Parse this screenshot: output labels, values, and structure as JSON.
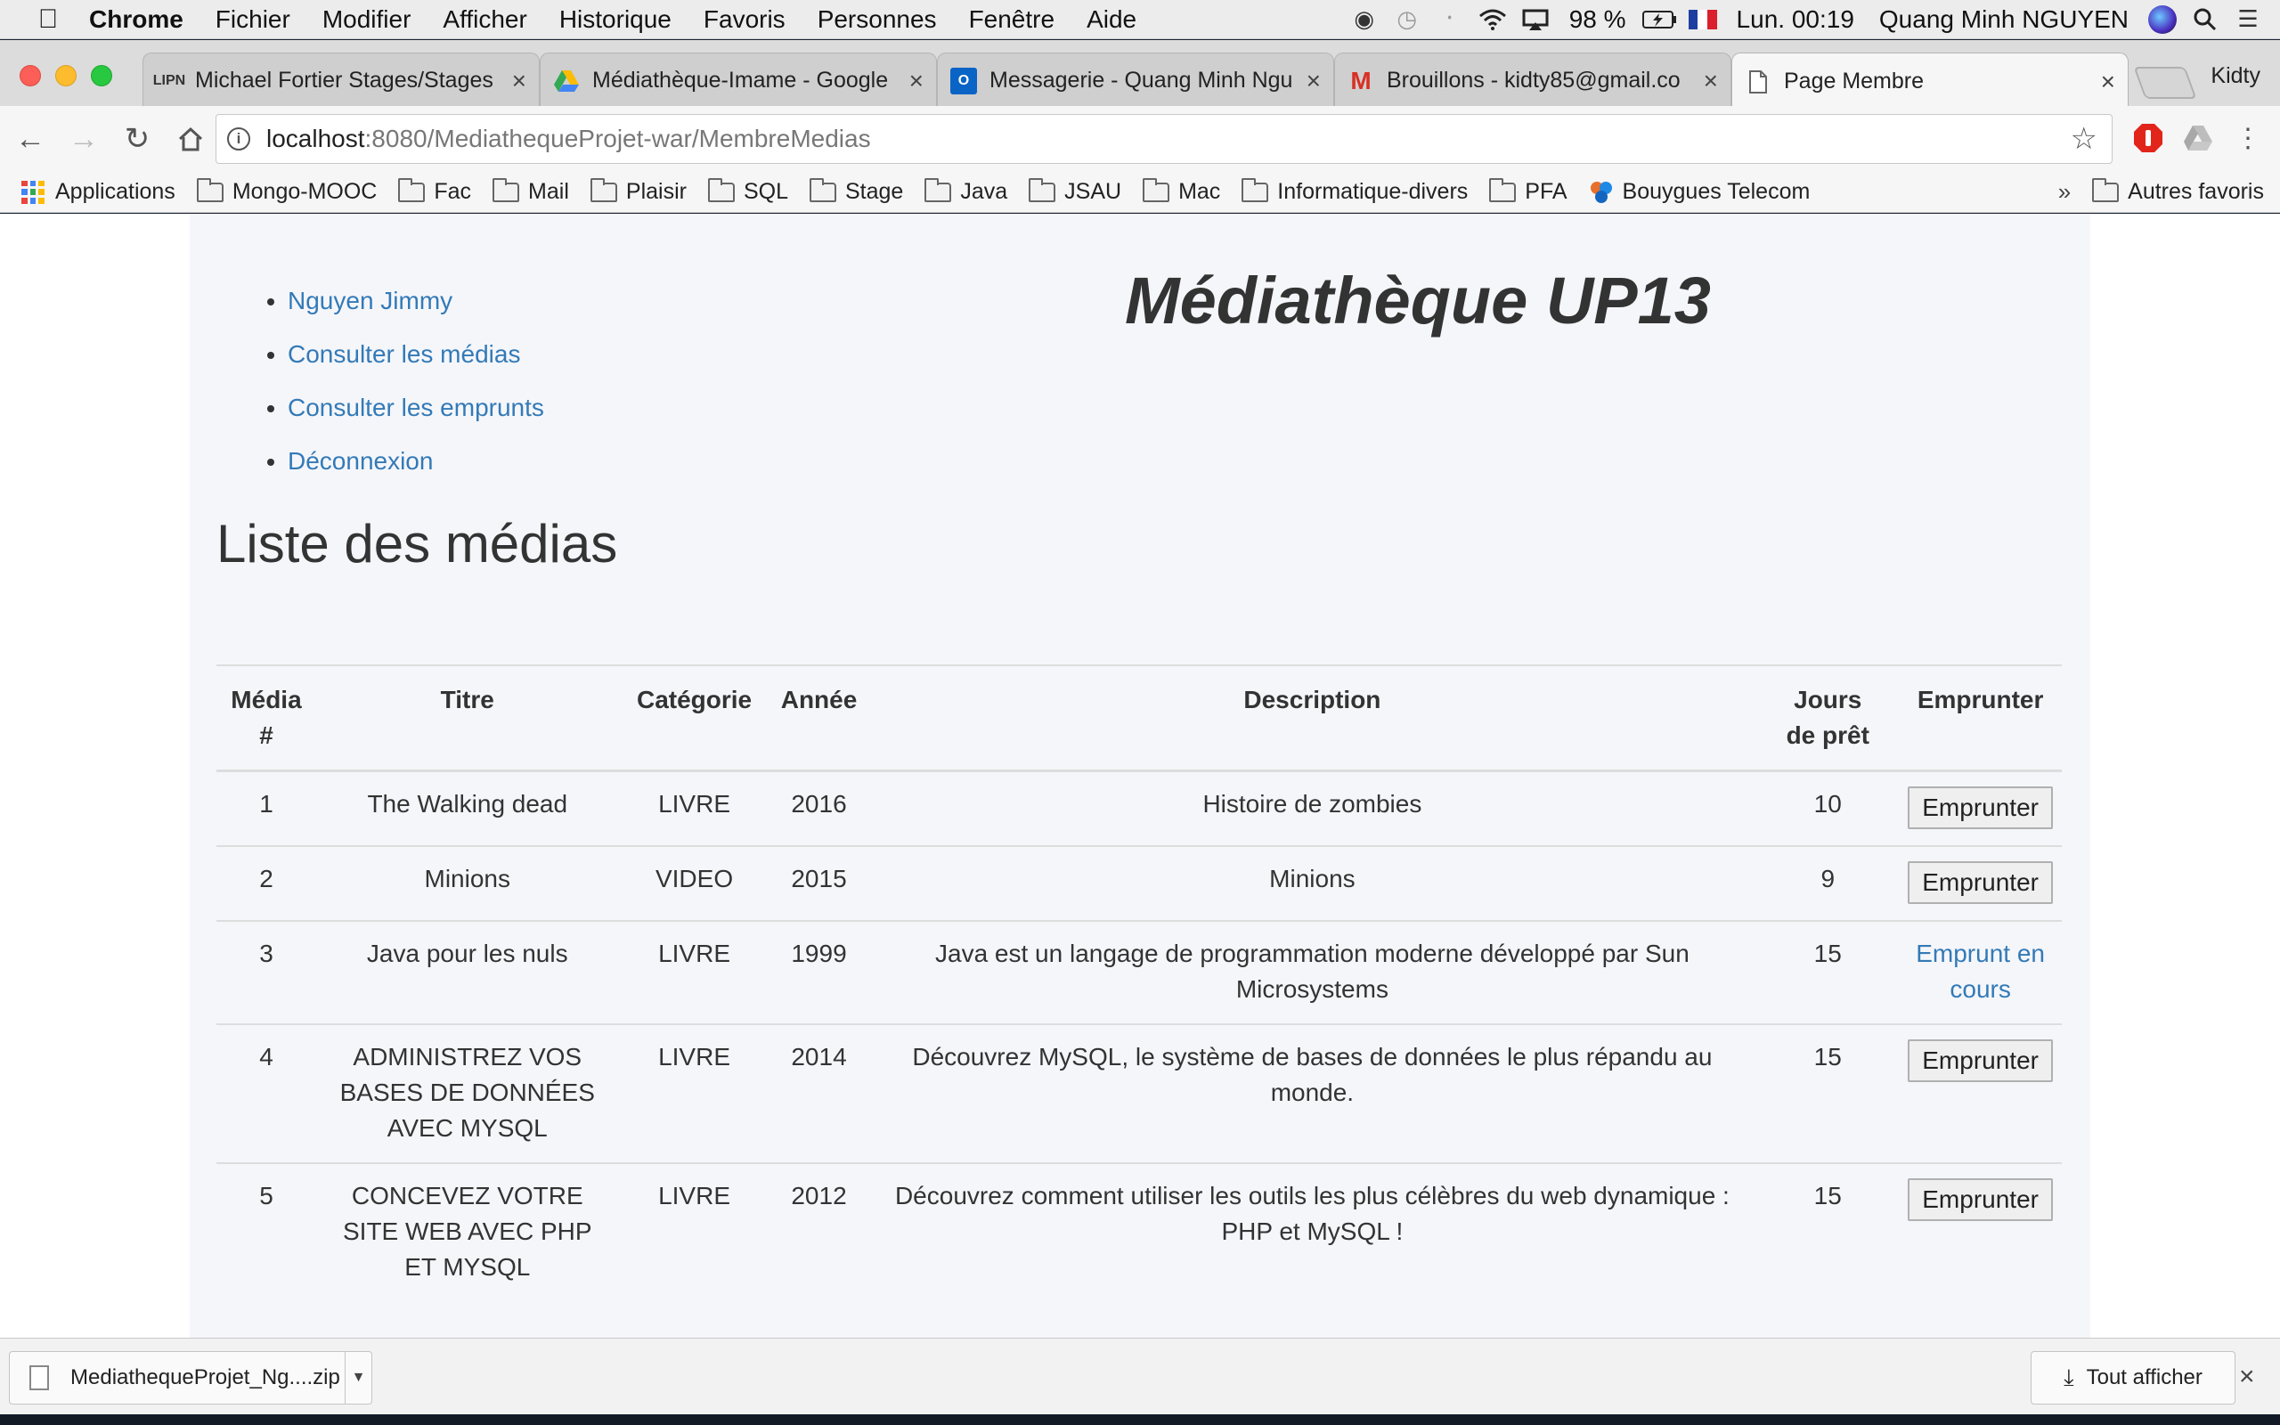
{
  "menubar": {
    "app": "Chrome",
    "menus": [
      "Fichier",
      "Modifier",
      "Afficher",
      "Historique",
      "Favoris",
      "Personnes",
      "Fenêtre",
      "Aide"
    ],
    "battery": "98 %",
    "clock": "Lun. 00:19",
    "user": "Quang Minh NGUYEN"
  },
  "tabs": [
    {
      "title": "Michael Fortier Stages/Stages",
      "favicon": "LIPN"
    },
    {
      "title": "Médiathèque-Imame - Google",
      "favicon": "drive"
    },
    {
      "title": "Messagerie - Quang Minh Ngu",
      "favicon": "outlook"
    },
    {
      "title": "Brouillons - kidty85@gmail.co",
      "favicon": "gmail"
    },
    {
      "title": "Page Membre",
      "favicon": "page"
    }
  ],
  "profile_name": "Kidty",
  "address": {
    "host": "localhost",
    "path": ":8080/MediathequeProjet-war/MembreMedias"
  },
  "bookmarks": [
    "Applications",
    "Mongo-MOOC",
    "Fac",
    "Mail",
    "Plaisir",
    "SQL",
    "Stage",
    "Java",
    "JSAU",
    "Mac",
    "Informatique-divers",
    "PFA",
    "Bouygues Telecom"
  ],
  "bookmarks_overflow": "»",
  "other_bookmarks": "Autres favoris",
  "page": {
    "nav": [
      "Nguyen Jimmy",
      "Consulter les médias",
      "Consulter les emprunts",
      "Déconnexion"
    ],
    "site_title": "Médiathèque UP13",
    "heading": "Liste des médias",
    "table": {
      "headers": [
        "Média #",
        "Titre",
        "Catégorie",
        "Année",
        "Description",
        "Jours de prêt",
        "Emprunter"
      ],
      "rows": [
        {
          "id": "1",
          "title": "The Walking dead",
          "category": "LIVRE",
          "year": "2016",
          "description": "Histoire de zombies",
          "days": "10",
          "action": "Emprunter",
          "action_type": "button"
        },
        {
          "id": "2",
          "title": "Minions",
          "category": "VIDEO",
          "year": "2015",
          "description": "Minions",
          "days": "9",
          "action": "Emprunter",
          "action_type": "button"
        },
        {
          "id": "3",
          "title": "Java pour les nuls",
          "category": "LIVRE",
          "year": "1999",
          "description": "Java est un langage de programmation moderne développé par Sun Microsystems",
          "days": "15",
          "action": "Emprunt en cours",
          "action_type": "link"
        },
        {
          "id": "4",
          "title": "ADMINISTREZ VOS BASES DE DONNÉES AVEC MYSQL",
          "category": "LIVRE",
          "year": "2014",
          "description": "Découvrez MySQL, le système de bases de données le plus répandu au monde.",
          "days": "15",
          "action": "Emprunter",
          "action_type": "button"
        },
        {
          "id": "5",
          "title": "CONCEVEZ VOTRE SITE WEB AVEC PHP ET MYSQL",
          "category": "LIVRE",
          "year": "2012",
          "description": "Découvrez comment utiliser les outils les plus célèbres du web dynamique : PHP et MySQL !",
          "days": "15",
          "action": "Emprunter",
          "action_type": "button"
        }
      ]
    }
  },
  "download": {
    "filename": "MediathequeProjet_Ng....zip",
    "show_all": "Tout afficher"
  },
  "colors": {
    "link": "#337ab7",
    "container_bg": "#f5f6fa",
    "border": "#dddddd"
  }
}
